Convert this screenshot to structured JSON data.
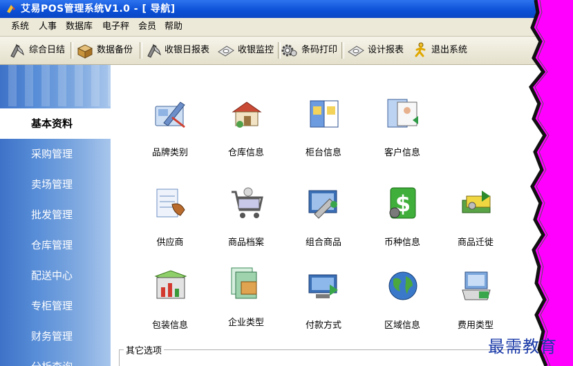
{
  "window": {
    "title": "艾易POS管理系统V1.0 - [ 导航]"
  },
  "menu": [
    "系统",
    "人事",
    "数据库",
    "电子秤",
    "会员",
    "帮助"
  ],
  "toolbar": {
    "buttons": [
      "综合日结",
      "数据备份",
      "收银日报表",
      "收银监控",
      "条码打印",
      "设计报表",
      "退出系统"
    ]
  },
  "sidebar": {
    "items": [
      "基本资料",
      "采购管理",
      "卖场管理",
      "批发管理",
      "仓库管理",
      "配送中心",
      "专柜管理",
      "财务管理",
      "分析查询"
    ],
    "active": "基本资料"
  },
  "main": {
    "tiles": [
      {
        "label": "品牌类别",
        "icon": "brand-category-icon"
      },
      {
        "label": "仓库信息",
        "icon": "warehouse-icon"
      },
      {
        "label": "柜台信息",
        "icon": "counter-icon"
      },
      {
        "label": "客户信息",
        "icon": "customer-icon"
      },
      {
        "label": "供应商",
        "icon": "supplier-icon"
      },
      {
        "label": "商品档案",
        "icon": "shopping-cart-icon"
      },
      {
        "label": "组合商品",
        "icon": "combo-product-icon"
      },
      {
        "label": "币种信息",
        "icon": "dollar-icon"
      },
      {
        "label": "商品迁徙",
        "icon": "money-transfer-icon"
      },
      {
        "label": "包装信息",
        "icon": "package-chart-icon"
      },
      {
        "label": "企业类型",
        "icon": "enterprise-type-icon"
      },
      {
        "label": "付款方式",
        "icon": "payment-method-icon"
      },
      {
        "label": "区域信息",
        "icon": "globe-icon"
      },
      {
        "label": "费用类型",
        "icon": "fee-type-icon"
      }
    ],
    "other_options_label": "其它选项"
  },
  "watermark": "最需教育",
  "colors": {
    "titlebar": "#0b4fd6",
    "sidebar": "#5a8fd8",
    "background": "#ff00ff"
  }
}
